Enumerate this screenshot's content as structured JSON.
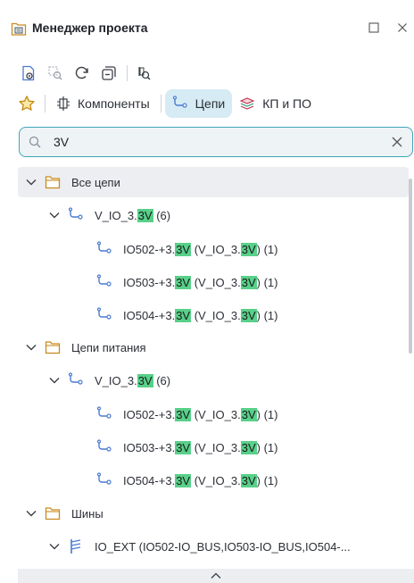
{
  "title": "Менеджер проекта",
  "tabs": [
    {
      "label": "Компоненты"
    },
    {
      "label": "Цепи"
    },
    {
      "label": "КП и ПО"
    }
  ],
  "search": {
    "value": "3V",
    "placeholder": ""
  },
  "tree": {
    "all_nets": {
      "label": "Все цепи"
    },
    "power_nets": {
      "label": "Цепи питания"
    },
    "buses": {
      "label": "Шины"
    },
    "net_group": {
      "pre": "V_IO_3.",
      "hl": "3V",
      "post": " (6)"
    },
    "nets": [
      {
        "a": "IO502-+3.",
        "b": "3V",
        "c": " (V_IO_3.",
        "d": "3V",
        "e": ") (1)"
      },
      {
        "a": "IO503-+3.",
        "b": "3V",
        "c": " (V_IO_3.",
        "d": "3V",
        "e": ") (1)"
      },
      {
        "a": "IO504-+3.",
        "b": "3V",
        "c": " (V_IO_3.",
        "d": "3V",
        "e": ") (1)"
      }
    ],
    "bus_item": {
      "label": "IO_EXT (IO502-IO_BUS,IO503-IO_BUS,IO504-..."
    }
  },
  "colors": {
    "accent": "#3fa6b4",
    "highlight": "#58d089",
    "active_tab": "#d6ebf4",
    "net_icon": "#4a7bd1"
  }
}
